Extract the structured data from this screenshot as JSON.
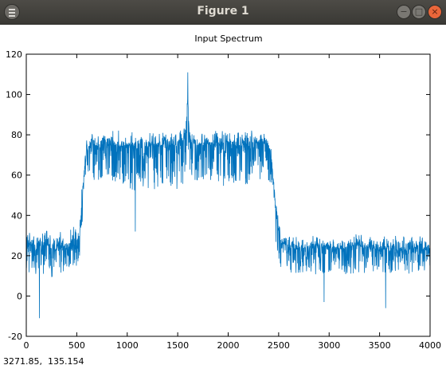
{
  "window": {
    "title": "Figure 1",
    "buttons": {
      "minimize": "−",
      "maximize": "□",
      "close": "×"
    },
    "menu_icon": "hamburger-menu-icon"
  },
  "status_bar": {
    "coordinates": "3271.85,  135.154"
  },
  "chart_data": {
    "type": "line",
    "title": "Input Spectrum",
    "xlabel": "",
    "ylabel": "",
    "xlim": [
      0,
      4000
    ],
    "ylim": [
      -20,
      120
    ],
    "xticks": [
      0,
      500,
      1000,
      1500,
      2000,
      2500,
      3000,
      3500,
      4000
    ],
    "yticks": [
      -20,
      0,
      20,
      40,
      60,
      80,
      100,
      120
    ],
    "grid": false,
    "line_color": "#0072bd",
    "series": [
      {
        "x": [
          0,
          40,
          80,
          120,
          160,
          200,
          240,
          280,
          320,
          360,
          400,
          440,
          480,
          520,
          540,
          560,
          580,
          600,
          640,
          680,
          720,
          760,
          800,
          900,
          1000,
          1100,
          1200,
          1300,
          1400,
          1500,
          1560,
          1580,
          1600,
          1610,
          1620,
          1640,
          1700,
          1800,
          1900,
          2000,
          2100,
          2200,
          2300,
          2350,
          2380,
          2400,
          2420,
          2440,
          2460,
          2480,
          2520,
          2600,
          2700,
          2800,
          2900,
          3000,
          3100,
          3200,
          3300,
          3400,
          3500,
          3600,
          3700,
          3800,
          3900,
          3990
        ],
        "y": [
          24,
          26,
          22,
          25,
          23,
          27,
          24,
          22,
          25,
          26,
          23,
          24,
          26,
          27,
          40,
          52,
          62,
          72,
          76,
          75,
          74,
          76,
          75,
          74,
          75,
          73,
          74,
          75,
          74,
          75,
          77,
          80,
          98,
          85,
          78,
          76,
          75,
          76,
          74,
          76,
          75,
          75,
          76,
          76,
          75,
          73,
          72,
          62,
          50,
          38,
          27,
          24,
          23,
          24,
          25,
          24,
          23,
          24,
          25,
          24,
          23,
          24,
          22,
          23,
          24,
          22
        ],
        "band_low": [
          14,
          10,
          12,
          9,
          10,
          12,
          8,
          11,
          12,
          10,
          13,
          11,
          12,
          15,
          26,
          38,
          50,
          60,
          58,
          56,
          57,
          58,
          55,
          56,
          54,
          50,
          52,
          53,
          55,
          52,
          56,
          60,
          70,
          64,
          58,
          55,
          56,
          57,
          54,
          55,
          56,
          54,
          57,
          58,
          56,
          56,
          54,
          46,
          34,
          22,
          12,
          10,
          11,
          12,
          10,
          11,
          12,
          10,
          11,
          12,
          10,
          11,
          12,
          11,
          12,
          12
        ],
        "band_high": [
          32,
          34,
          31,
          33,
          32,
          35,
          33,
          32,
          33,
          34,
          33,
          34,
          35,
          34,
          48,
          62,
          72,
          82,
          84,
          82,
          83,
          84,
          82,
          83,
          82,
          81,
          82,
          82,
          83,
          81,
          85,
          90,
          111,
          92,
          86,
          84,
          83,
          83,
          82,
          83,
          82,
          83,
          83,
          82,
          82,
          80,
          78,
          70,
          58,
          46,
          32,
          30,
          31,
          32,
          30,
          31,
          30,
          31,
          32,
          30,
          31,
          30,
          31,
          30,
          31,
          30
        ],
        "spikes": [
          [
            130,
            -11
          ],
          [
            1080,
            32
          ],
          [
            1600,
            111
          ],
          [
            2950,
            -3
          ],
          [
            3560,
            -6
          ]
        ]
      }
    ]
  }
}
